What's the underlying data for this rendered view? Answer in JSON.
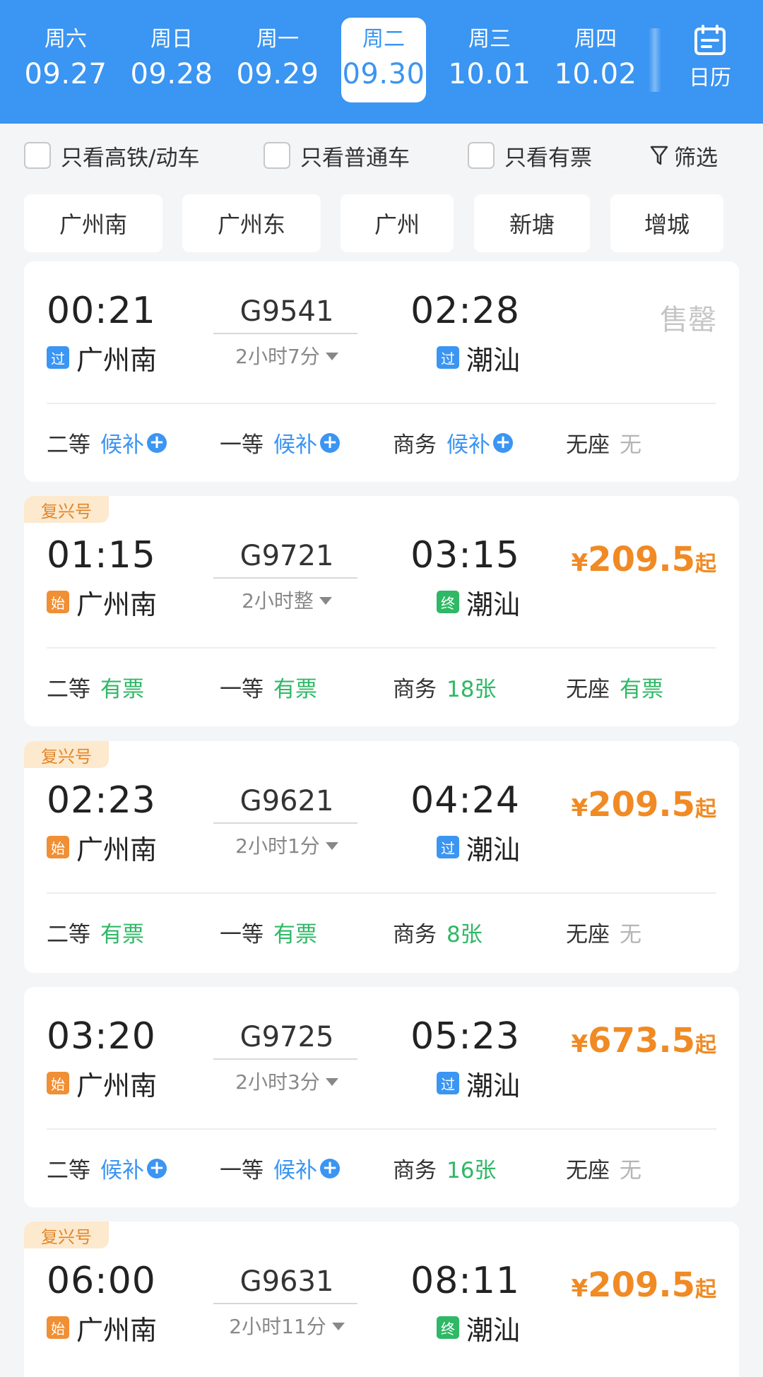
{
  "date_bar": {
    "days": [
      {
        "weekday": "周六",
        "date": "09.27"
      },
      {
        "weekday": "周日",
        "date": "09.28"
      },
      {
        "weekday": "周一",
        "date": "09.29"
      },
      {
        "weekday": "周二",
        "date": "09.30",
        "selected": true
      },
      {
        "weekday": "周三",
        "date": "10.01"
      },
      {
        "weekday": "周四",
        "date": "10.02"
      }
    ],
    "calendar_label": "日历"
  },
  "filters": {
    "high_speed": "只看高铁/动车",
    "regular": "只看普通车",
    "available": "只看有票",
    "filter_label": "筛选"
  },
  "stations": [
    "广州南",
    "广州东",
    "广州",
    "新塘",
    "增城"
  ],
  "trains": [
    {
      "badge": "",
      "dep_time": "00:21",
      "dep_station": "广州南",
      "dep_tag": "过",
      "train_no": "G9541",
      "duration": "2小时7分",
      "arr_time": "02:28",
      "arr_station": "潮汕",
      "arr_tag": "过",
      "price": "",
      "status": "售罄",
      "seats": [
        {
          "label": "二等",
          "value": "候补",
          "plus": true
        },
        {
          "label": "一等",
          "value": "候补",
          "plus": true
        },
        {
          "label": "商务",
          "value": "候补",
          "plus": true
        },
        {
          "label": "无座",
          "value": "无"
        }
      ]
    },
    {
      "badge": "复兴号",
      "dep_time": "01:15",
      "dep_station": "广州南",
      "dep_tag": "始",
      "train_no": "G9721",
      "duration": "2小时整",
      "arr_time": "03:15",
      "arr_station": "潮汕",
      "arr_tag": "终",
      "price": "209.5",
      "price_prefix": "¥",
      "price_suffix": "起",
      "seats": [
        {
          "label": "二等",
          "value": "有票"
        },
        {
          "label": "一等",
          "value": "有票"
        },
        {
          "label": "商务",
          "value": "18张"
        },
        {
          "label": "无座",
          "value": "有票"
        }
      ]
    },
    {
      "badge": "复兴号",
      "dep_time": "02:23",
      "dep_station": "广州南",
      "dep_tag": "始",
      "train_no": "G9621",
      "duration": "2小时1分",
      "arr_time": "04:24",
      "arr_station": "潮汕",
      "arr_tag": "过",
      "price": "209.5",
      "price_prefix": "¥",
      "price_suffix": "起",
      "seats": [
        {
          "label": "二等",
          "value": "有票"
        },
        {
          "label": "一等",
          "value": "有票"
        },
        {
          "label": "商务",
          "value": "8张"
        },
        {
          "label": "无座",
          "value": "无"
        }
      ]
    },
    {
      "badge": "",
      "dep_time": "03:20",
      "dep_station": "广州南",
      "dep_tag": "始",
      "train_no": "G9725",
      "duration": "2小时3分",
      "arr_time": "05:23",
      "arr_station": "潮汕",
      "arr_tag": "过",
      "price": "673.5",
      "price_prefix": "¥",
      "price_suffix": "起",
      "seats": [
        {
          "label": "二等",
          "value": "候补",
          "plus": true
        },
        {
          "label": "一等",
          "value": "候补",
          "plus": true
        },
        {
          "label": "商务",
          "value": "16张"
        },
        {
          "label": "无座",
          "value": "无"
        }
      ]
    },
    {
      "badge": "复兴号",
      "dep_time": "06:00",
      "dep_station": "广州南",
      "dep_tag": "始",
      "train_no": "G9631",
      "duration": "2小时11分",
      "arr_time": "08:11",
      "arr_station": "潮汕",
      "arr_tag": "终",
      "price": "209.5",
      "price_prefix": "¥",
      "price_suffix": "起"
    }
  ],
  "colors": {
    "primary_blue": "#3b95f2",
    "price_orange": "#f08a24",
    "available_green": "#2fb865",
    "badge_bg": "#fde9cd"
  }
}
